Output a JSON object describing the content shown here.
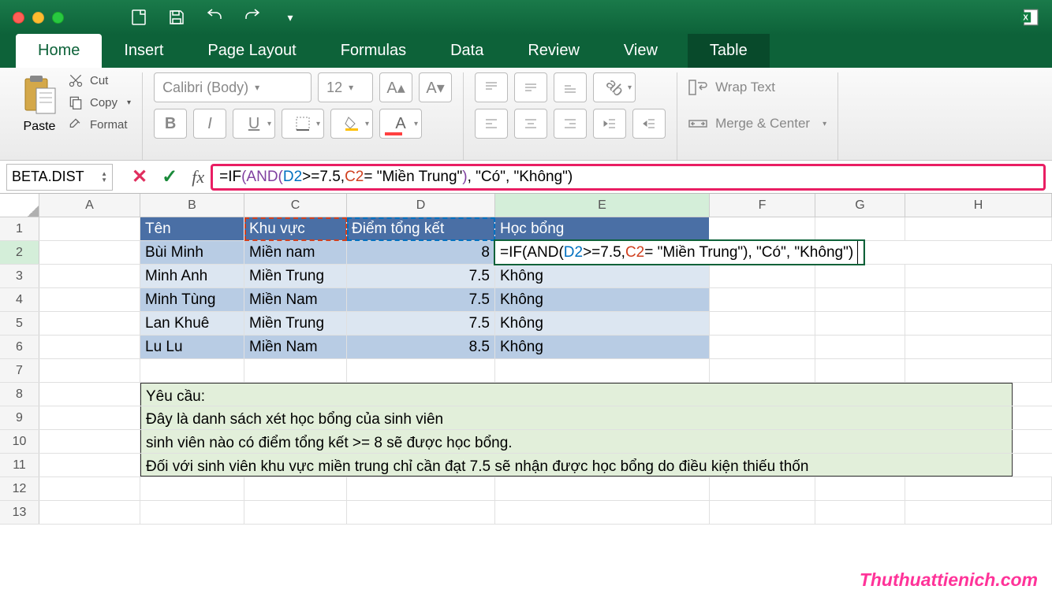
{
  "namebox": "BETA.DIST",
  "formula": {
    "prefix": "=IF",
    "and_open": "(AND",
    "paren": "(",
    "d2": "D2",
    "cond1_rest": ">=7.5,",
    "c2": "C2",
    "cond2_rest": "= \"Miền Trung\"",
    "close1": ")",
    "tail": ", \"Có\", \"Không\")"
  },
  "tabs": [
    "Home",
    "Insert",
    "Page Layout",
    "Formulas",
    "Data",
    "Review",
    "View",
    "Table"
  ],
  "clipboard": {
    "paste": "Paste",
    "cut": "Cut",
    "copy": "Copy",
    "format": "Format"
  },
  "font": {
    "name": "Calibri (Body)",
    "size": "12"
  },
  "merge": {
    "wrap": "Wrap Text",
    "merge": "Merge & Center"
  },
  "columns": [
    "A",
    "B",
    "C",
    "D",
    "E",
    "F",
    "G",
    "H"
  ],
  "headers": {
    "b": "Tên",
    "c": "Khu vực",
    "d": "Điểm tổng kết",
    "e": "Học bổng"
  },
  "rows": [
    {
      "n": "2",
      "ten": "Bùi Minh",
      "kv": "Miền nam",
      "diem": "8",
      "hb_formula": true
    },
    {
      "n": "3",
      "ten": "Minh Anh",
      "kv": "Miền Trung",
      "diem": "7.5",
      "hb": "Không"
    },
    {
      "n": "4",
      "ten": "Minh Tùng",
      "kv": "Miền Nam",
      "diem": "7.5",
      "hb": "Không"
    },
    {
      "n": "5",
      "ten": "Lan Khuê",
      "kv": "Miền Trung",
      "diem": "7.5",
      "hb": "Không"
    },
    {
      "n": "6",
      "ten": "Lu Lu",
      "kv": "Miền Nam",
      "diem": "8.5",
      "hb": "Không"
    }
  ],
  "note": {
    "l1": "Yêu cầu:",
    "l2": "Đây là danh sách xét học bổng của sinh viên",
    "l3": "sinh viên nào có điểm tổng kết >= 8 sẽ được học bổng.",
    "l4": "Đối với sinh viên khu vực miền trung chỉ cần đạt 7.5 sẽ nhận được học bổng do điều kiện thiếu thốn"
  },
  "watermark": "Thuthuattienich.com",
  "active_formula_display": "=IF(AND(D2>=7.5,C2= \"Miền Trung\"), \"Có\", \"Không\")"
}
